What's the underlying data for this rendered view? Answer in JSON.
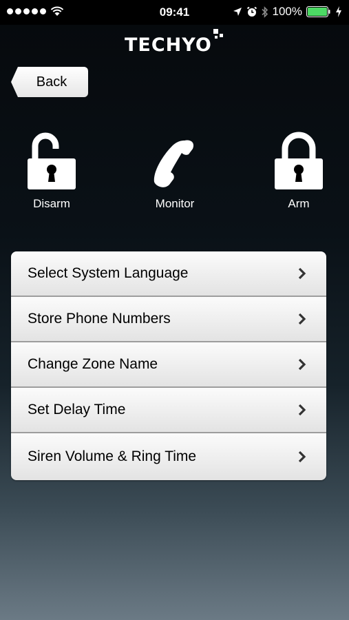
{
  "status_bar": {
    "time": "09:41",
    "battery_percent": "100%",
    "signal_bars": 5
  },
  "brand": {
    "logo_text": "TECHYO"
  },
  "back_button": {
    "label": "Back"
  },
  "actions": [
    {
      "label": "Disarm",
      "icon": "unlocked-padlock-icon"
    },
    {
      "label": "Monitor",
      "icon": "phone-handset-icon"
    },
    {
      "label": "Arm",
      "icon": "locked-padlock-icon"
    }
  ],
  "menu": {
    "items": [
      {
        "label": "Select System Language"
      },
      {
        "label": "Store Phone Numbers"
      },
      {
        "label": "Change Zone Name"
      },
      {
        "label": "Set Delay Time"
      },
      {
        "label": "Siren Volume & Ring Time"
      }
    ]
  },
  "colors": {
    "battery": "#4cd964",
    "menu_text": "#000000",
    "background_top": "#06090c",
    "background_bottom": "#6b7a85"
  }
}
